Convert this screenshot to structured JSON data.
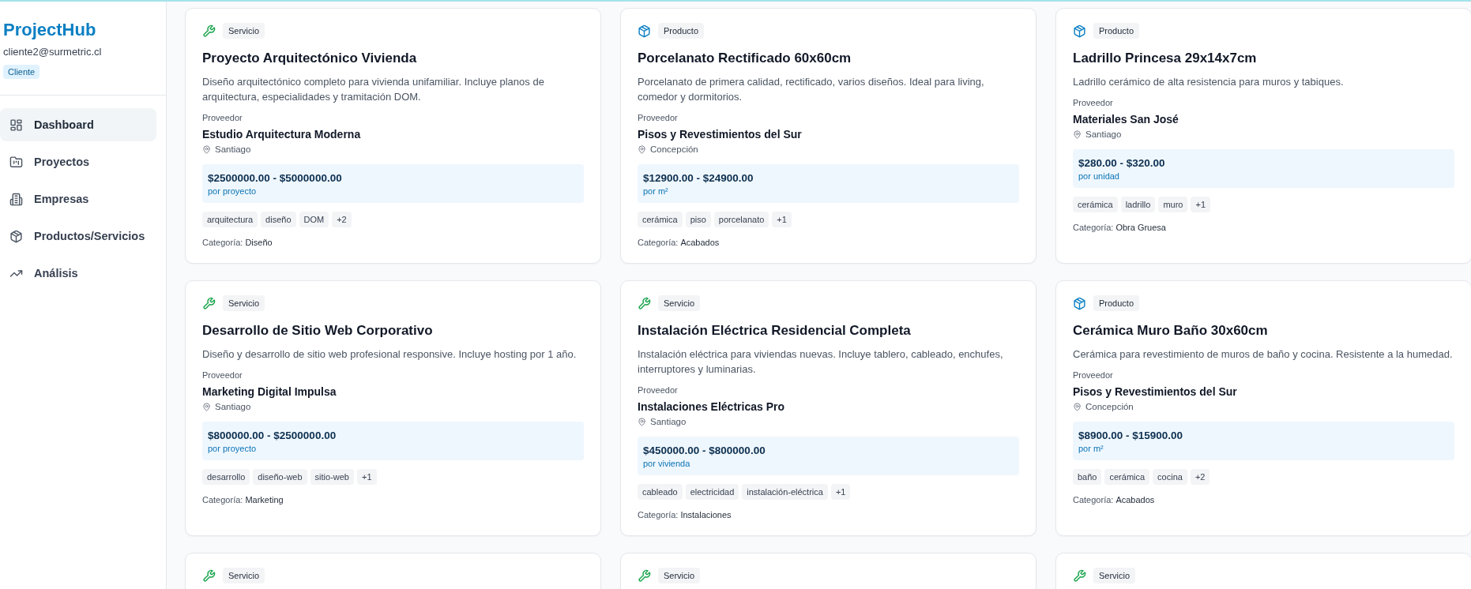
{
  "sidebar": {
    "logo": "ProjectHub",
    "email": "cliente2@surmetric.cl",
    "role_badge": "Cliente",
    "items": [
      {
        "label": "Dashboard",
        "selected": true
      },
      {
        "label": "Proyectos",
        "selected": false
      },
      {
        "label": "Empresas",
        "selected": false
      },
      {
        "label": "Productos/Servicios",
        "selected": false
      },
      {
        "label": "Análisis",
        "selected": false
      }
    ]
  },
  "cards": [
    {
      "kind": "servicio",
      "type": "Servicio",
      "title": "Proyecto Arquitectónico Vivienda",
      "description": "Diseño arquitectónico completo para vivienda unifamiliar. Incluye planos de arquitectura, especialidades y tramitación DOM.",
      "provider_label": "Proveedor",
      "provider": "Estudio Arquitectura Moderna",
      "location": "Santiago",
      "price": "$2500000.00 - $5000000.00",
      "unit": "por proyecto",
      "tags": [
        "arquitectura",
        "diseño",
        "DOM",
        "+2"
      ],
      "category_label": "Categoría:",
      "category": "Diseño"
    },
    {
      "kind": "producto",
      "type": "Producto",
      "title": "Porcelanato Rectificado 60x60cm",
      "description": "Porcelanato de primera calidad, rectificado, varios diseños. Ideal para living, comedor y dormitorios.",
      "provider_label": "Proveedor",
      "provider": "Pisos y Revestimientos del Sur",
      "location": "Concepción",
      "price": "$12900.00 - $24900.00",
      "unit": "por m²",
      "tags": [
        "cerámica",
        "piso",
        "porcelanato",
        "+1"
      ],
      "category_label": "Categoría:",
      "category": "Acabados"
    },
    {
      "kind": "producto",
      "type": "Producto",
      "title": "Ladrillo Princesa 29x14x7cm",
      "description": "Ladrillo cerámico de alta resistencia para muros y tabiques.",
      "provider_label": "Proveedor",
      "provider": "Materiales San José",
      "location": "Santiago",
      "price": "$280.00 - $320.00",
      "unit": "por unidad",
      "tags": [
        "cerámica",
        "ladrillo",
        "muro",
        "+1"
      ],
      "category_label": "Categoría:",
      "category": "Obra Gruesa"
    },
    {
      "kind": "servicio",
      "type": "Servicio",
      "title": "Desarrollo de Sitio Web Corporativo",
      "description": "Diseño y desarrollo de sitio web profesional responsive. Incluye hosting por 1 año.",
      "provider_label": "Proveedor",
      "provider": "Marketing Digital Impulsa",
      "location": "Santiago",
      "price": "$800000.00 - $2500000.00",
      "unit": "por proyecto",
      "tags": [
        "desarrollo",
        "diseño-web",
        "sitio-web",
        "+1"
      ],
      "category_label": "Categoría:",
      "category": "Marketing"
    },
    {
      "kind": "servicio",
      "type": "Servicio",
      "title": "Instalación Eléctrica Residencial Completa",
      "description": "Instalación eléctrica para viviendas nuevas. Incluye tablero, cableado, enchufes, interruptores y luminarias.",
      "provider_label": "Proveedor",
      "provider": "Instalaciones Eléctricas Pro",
      "location": "Santiago",
      "price": "$450000.00 - $800000.00",
      "unit": "por vivienda",
      "tags": [
        "cableado",
        "electricidad",
        "instalación-eléctrica",
        "+1"
      ],
      "category_label": "Categoría:",
      "category": "Instalaciones"
    },
    {
      "kind": "producto",
      "type": "Producto",
      "title": "Cerámica Muro Baño 30x60cm",
      "description": "Cerámica para revestimiento de muros de baño y cocina. Resistente a la humedad.",
      "provider_label": "Proveedor",
      "provider": "Pisos y Revestimientos del Sur",
      "location": "Concepción",
      "price": "$8900.00 - $15900.00",
      "unit": "por m²",
      "tags": [
        "baño",
        "cerámica",
        "cocina",
        "+2"
      ],
      "category_label": "Categoría:",
      "category": "Acabados"
    },
    {
      "kind": "servicio",
      "type": "Servicio"
    },
    {
      "kind": "servicio",
      "type": "Servicio"
    },
    {
      "kind": "servicio",
      "type": "Servicio"
    }
  ]
}
